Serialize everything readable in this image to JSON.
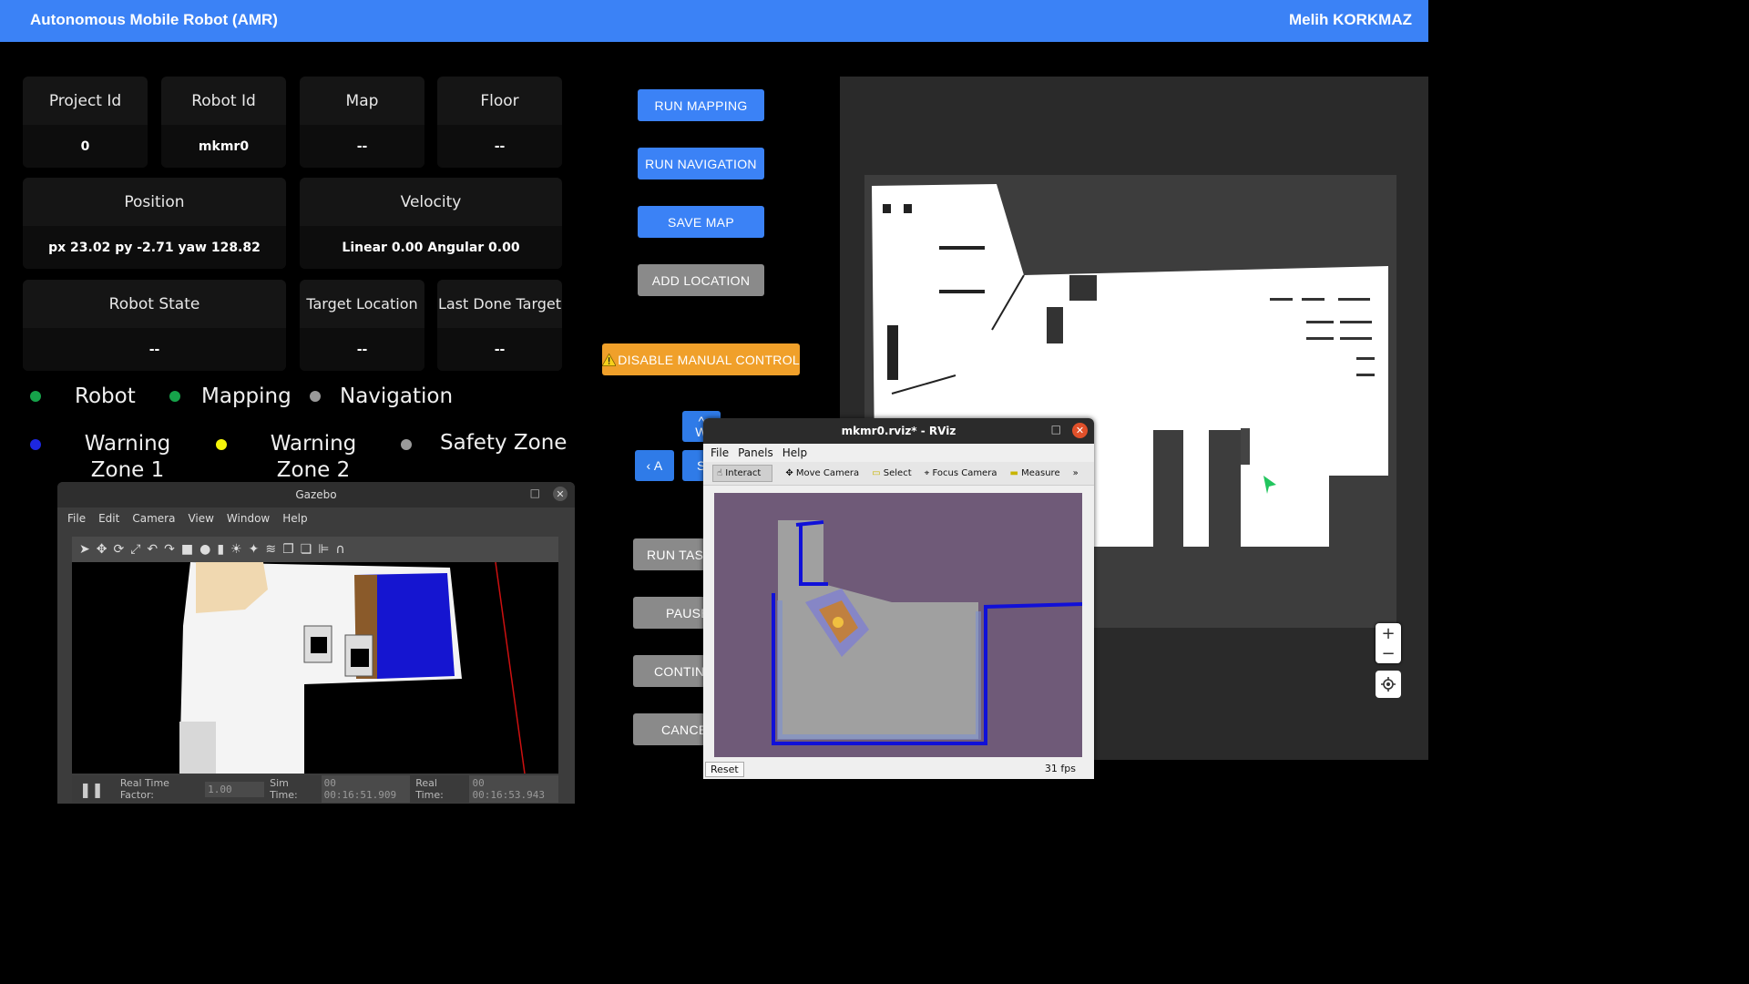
{
  "header": {
    "title": "Autonomous Mobile Robot (AMR)",
    "user": "Melih KORKMAZ"
  },
  "cards": {
    "project_id": {
      "label": "Project Id",
      "value": "0"
    },
    "robot_id": {
      "label": "Robot Id",
      "value": "mkmr0"
    },
    "map": {
      "label": "Map",
      "value": "--"
    },
    "floor": {
      "label": "Floor",
      "value": "--"
    },
    "position": {
      "label": "Position",
      "value": "px 23.02 py -2.71 yaw 128.82"
    },
    "velocity": {
      "label": "Velocity",
      "value": "Linear 0.00 Angular 0.00"
    },
    "robot_state": {
      "label": "Robot State",
      "value": "--"
    },
    "target_location": {
      "label": "Target Location",
      "value": "--"
    },
    "last_done_target": {
      "label": "Last Done Target",
      "value": "--"
    }
  },
  "status": {
    "robot": {
      "label": "Robot",
      "color": "#16a34a"
    },
    "mapping": {
      "label": "Mapping",
      "color": "#16a34a"
    },
    "navigation": {
      "label": "Navigation",
      "color": "#9a9a9a"
    },
    "warning_zone_1": {
      "line1": "Warning",
      "line2": "Zone 1",
      "color": "#1d27e0"
    },
    "warning_zone_2": {
      "line1": "Warning",
      "line2": "Zone 2",
      "color": "#f5f50a"
    },
    "safety_zone": {
      "label": "Safety Zone",
      "color": "#9a9a9a"
    }
  },
  "buttons": {
    "run_mapping": "RUN MAPPING",
    "run_navigation": "RUN NAVIGATION",
    "save_map": "SAVE MAP",
    "add_location": "ADD LOCATION",
    "disable_manual": "DISABLE MANUAL CONTROL",
    "up": "^",
    "up_sub": "W",
    "left": "‹ A",
    "down": "S",
    "run_task": "RUN TASK",
    "pause": "PAUSE",
    "continue": "CONTINUE",
    "cancel": "CANCEL"
  },
  "map_controls": {
    "zoom_in": "+",
    "zoom_out": "−"
  },
  "gazebo": {
    "title": "Gazebo",
    "menu": [
      "File",
      "Edit",
      "Camera",
      "View",
      "Window",
      "Help"
    ],
    "rtf_label": "Real Time Factor:",
    "rtf_value": "1.00",
    "sim_label": "Sim Time:",
    "sim_value": "00 00:16:51.909",
    "real_label": "Real Time:",
    "real_value": "00 00:16:53.943"
  },
  "rviz": {
    "title": "mkmr0.rviz* - RViz",
    "menu": [
      "File",
      "Panels",
      "Help"
    ],
    "tools": [
      "Interact",
      "Move Camera",
      "Select",
      "Focus Camera",
      "Measure"
    ],
    "reset": "Reset",
    "fps": "31 fps"
  }
}
